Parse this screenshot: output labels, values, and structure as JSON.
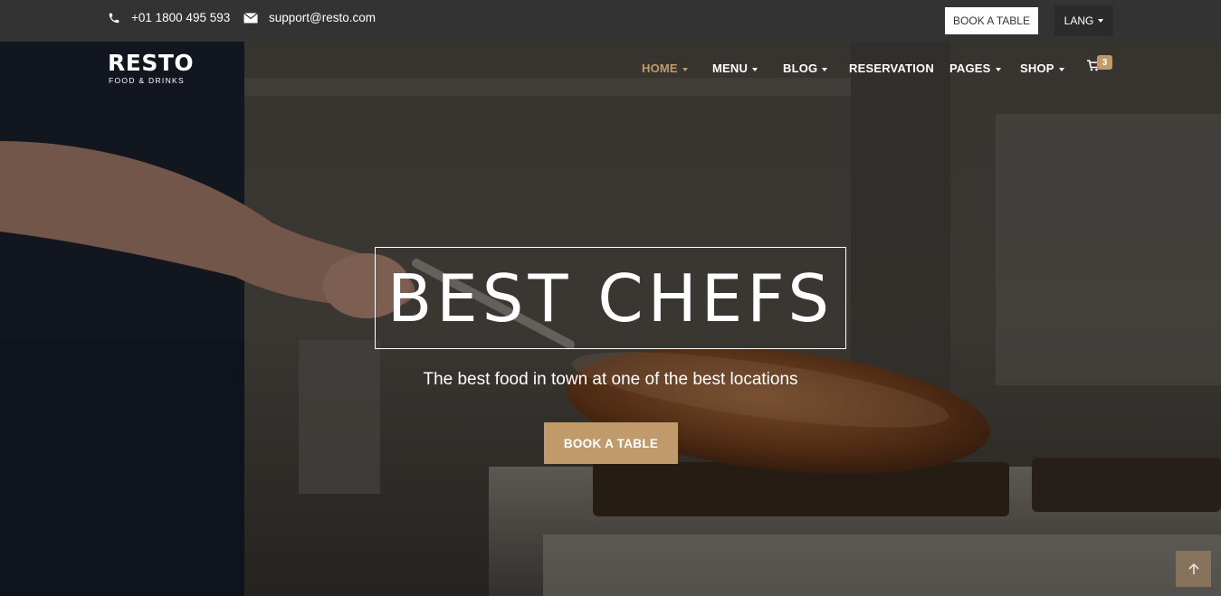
{
  "topbar": {
    "phone": "+01 1800 495 593",
    "email": "support@resto.com",
    "book_label": "BOOK A TABLE",
    "lang_label": "LANG"
  },
  "brand": {
    "name": "RESTO",
    "tagline": "FOOD & DRINKS"
  },
  "nav": {
    "items": [
      {
        "label": "HOME",
        "dropdown": true,
        "active": true
      },
      {
        "label": "MENU",
        "dropdown": true,
        "active": false
      },
      {
        "label": "BLOG",
        "dropdown": true,
        "active": false
      },
      {
        "label": "RESERVATION",
        "dropdown": false,
        "active": false
      },
      {
        "label": "PAGES",
        "dropdown": true,
        "active": false
      },
      {
        "label": "SHOP",
        "dropdown": true,
        "active": false
      }
    ],
    "cart_count": "3"
  },
  "hero": {
    "headline": "BEST CHEFS",
    "subline": "The best food in town at one of the best locations",
    "button_label": "BOOK A TABLE"
  },
  "colors": {
    "accent": "#c19a6b",
    "topbar_bg": "#333333"
  },
  "icons": {
    "phone": "phone-icon",
    "email": "envelope-icon",
    "cart": "cart-icon",
    "scroll_top": "arrow-up-icon"
  }
}
